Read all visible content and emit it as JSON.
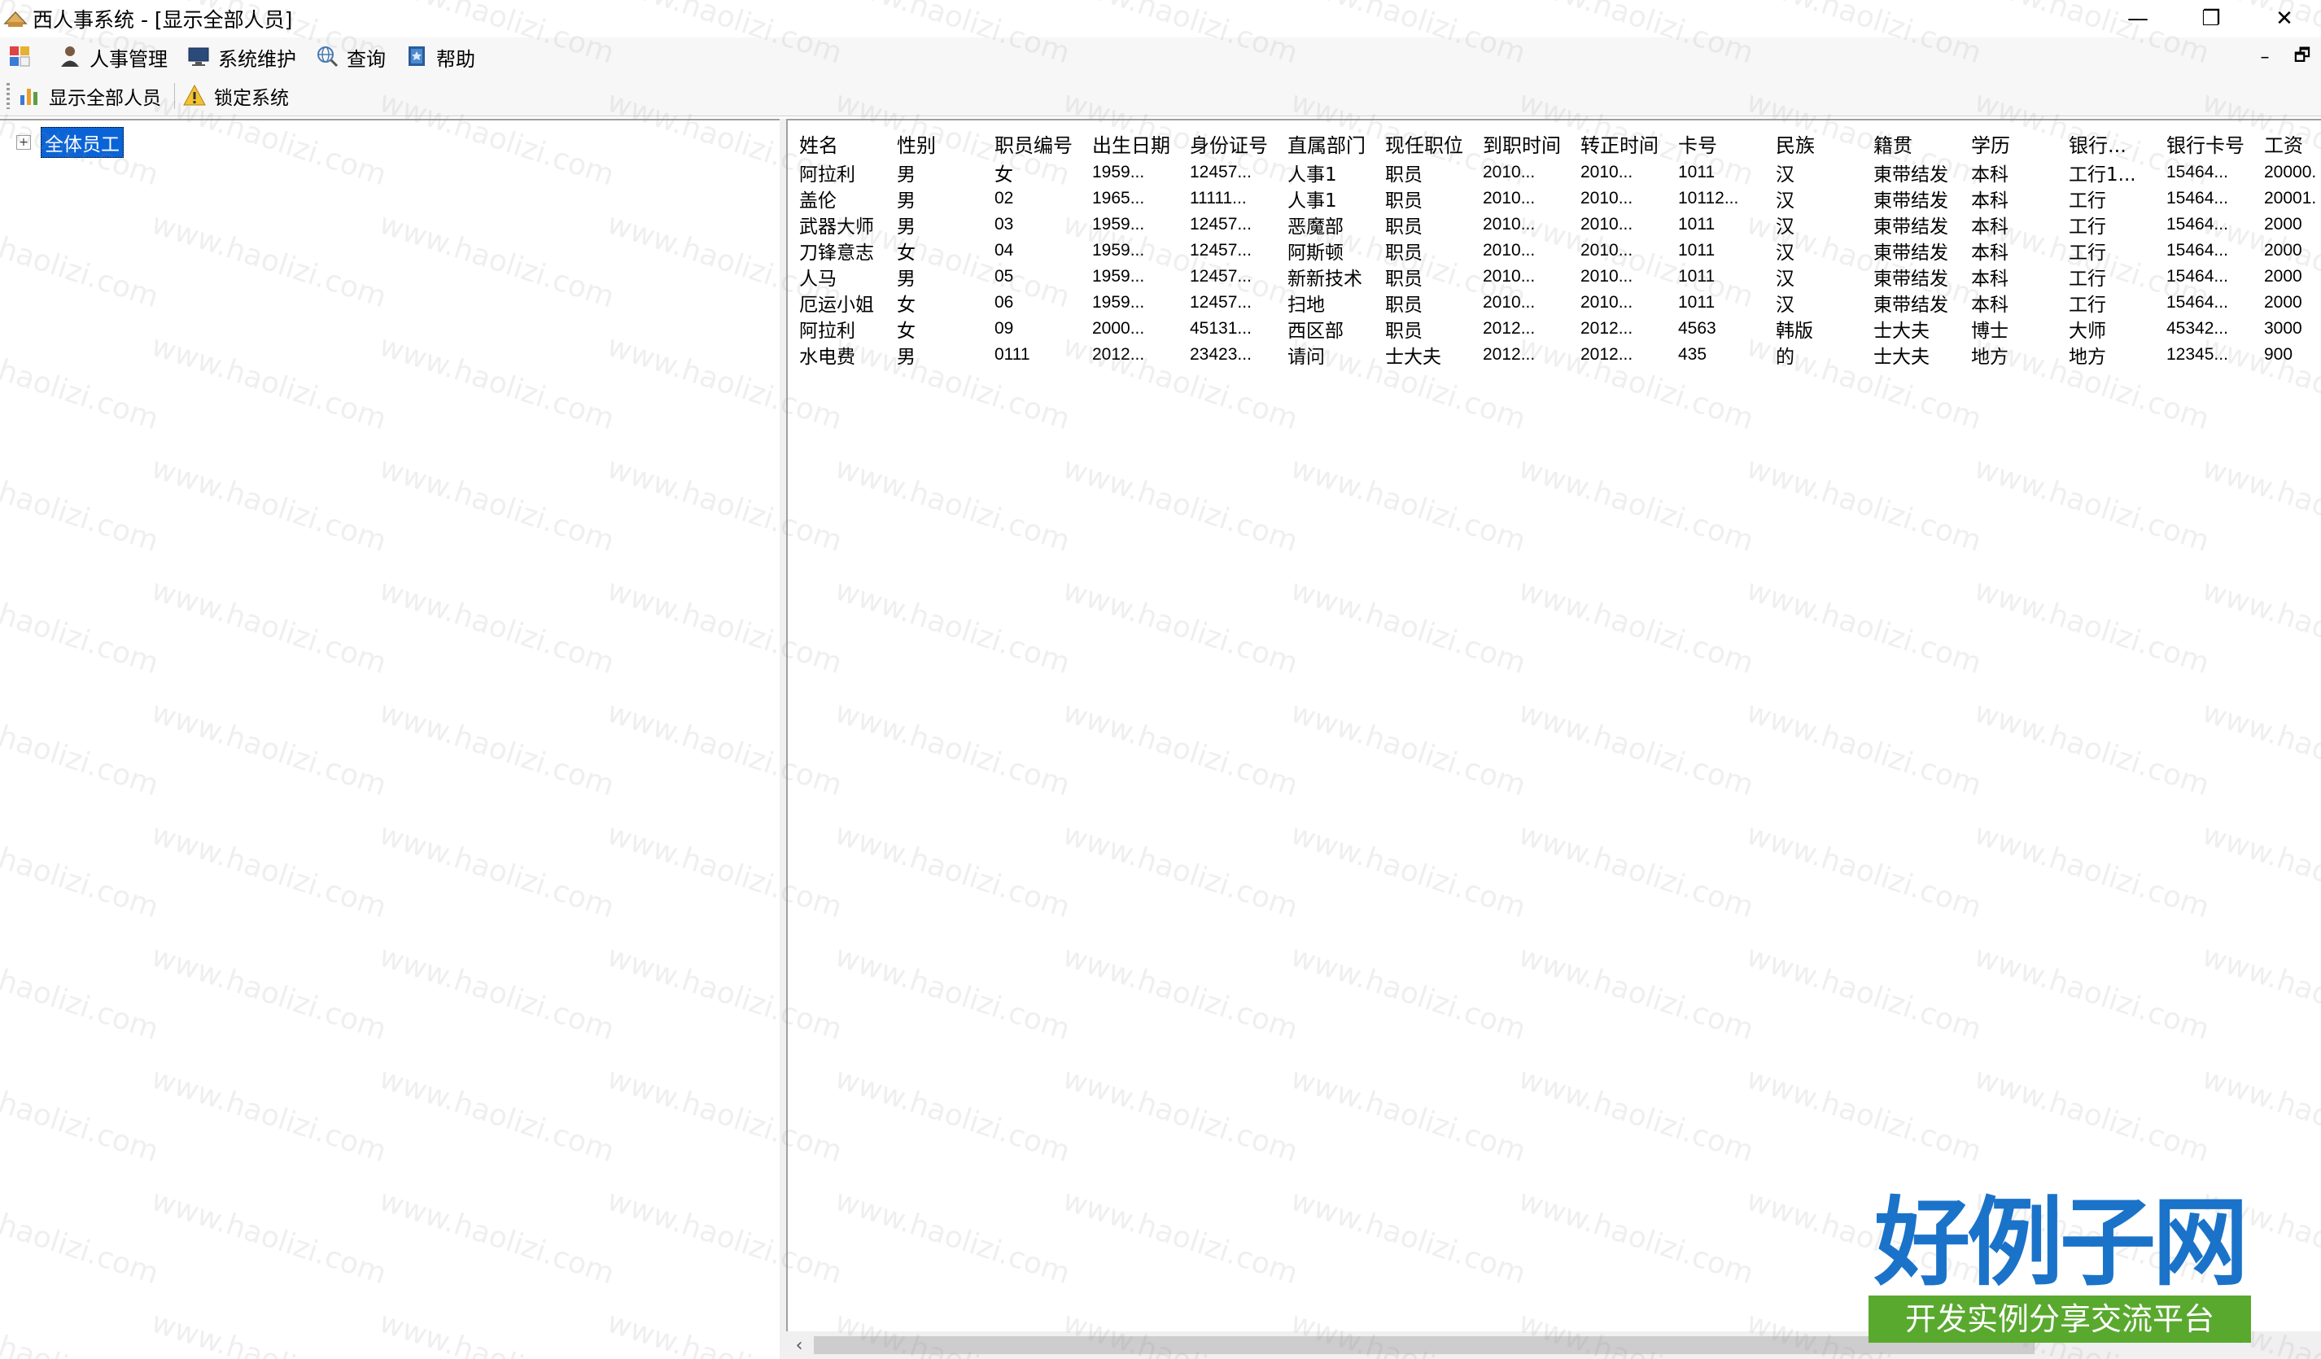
{
  "window": {
    "title": "西人事系统 - [显示全部人员]",
    "controls": {
      "minimize": "—",
      "restore": "❐",
      "close": "✕"
    }
  },
  "menu": {
    "items": [
      {
        "label": "人事管理",
        "icon": "person-icon"
      },
      {
        "label": "系统维护",
        "icon": "monitor-icon"
      },
      {
        "label": "查询",
        "icon": "globe-search-icon"
      },
      {
        "label": "帮助",
        "icon": "help-book-icon"
      }
    ],
    "mdi": {
      "minimize": "–",
      "restore": "🗗"
    }
  },
  "toolbar": {
    "items": [
      {
        "label": "显示全部人员",
        "icon": "bar-chart-icon"
      },
      {
        "label": "锁定系统",
        "icon": "warning-icon"
      }
    ]
  },
  "tree": {
    "root_label": "全体员工",
    "expander": "+"
  },
  "grid": {
    "columns": [
      "姓名",
      "性别",
      "职员编号",
      "出生日期",
      "身份证号",
      "直属部门",
      "现任职位",
      "到职时间",
      "转正时间",
      "卡号",
      "民族",
      "籍贯",
      "学历",
      "银行...",
      "银行卡号",
      "工资"
    ],
    "rows": [
      [
        "阿拉利",
        "男",
        "女",
        "1959...",
        "12457...",
        "人事1",
        "职员",
        "2010...",
        "2010...",
        "1011",
        "汉",
        "東带结发",
        "本科",
        "工行1...",
        "15464...",
        "20000."
      ],
      [
        "盖伦",
        "男",
        "02",
        "1965...",
        "11111...",
        "人事1",
        "职员",
        "2010...",
        "2010...",
        "10112...",
        "汉",
        "東带结发",
        "本科",
        "工行",
        "15464...",
        "20001."
      ],
      [
        "武器大师",
        "男",
        "03",
        "1959...",
        "12457...",
        "恶魔部",
        "职员",
        "2010...",
        "2010...",
        "1011",
        "汉",
        "東带结发",
        "本科",
        "工行",
        "15464...",
        "2000"
      ],
      [
        "刀锋意志",
        "女",
        "04",
        "1959...",
        "12457...",
        "阿斯顿",
        "职员",
        "2010...",
        "2010...",
        "1011",
        "汉",
        "東带结发",
        "本科",
        "工行",
        "15464...",
        "2000"
      ],
      [
        "人马",
        "男",
        "05",
        "1959...",
        "12457...",
        "新新技术",
        "职员",
        "2010...",
        "2010...",
        "1011",
        "汉",
        "東带结发",
        "本科",
        "工行",
        "15464...",
        "2000"
      ],
      [
        "厄运小姐",
        "女",
        "06",
        "1959...",
        "12457...",
        "扫地",
        "职员",
        "2010...",
        "2010...",
        "1011",
        "汉",
        "東带结发",
        "本科",
        "工行",
        "15464...",
        "2000"
      ],
      [
        "阿拉利",
        "女",
        "09",
        "2000...",
        "45131...",
        "西区部",
        "职员",
        "2012...",
        "2012...",
        "4563",
        "韩版",
        "士大夫",
        "博士",
        "大师",
        "45342...",
        "3000"
      ],
      [
        "水电费",
        "男",
        "0111",
        "2012...",
        "23423...",
        "请问",
        "士大夫",
        "2012...",
        "2012...",
        "435",
        "的",
        "士大夫",
        "地方",
        "地方",
        "12345...",
        "900"
      ]
    ]
  },
  "scrollbar": {
    "left_arrow": "‹"
  },
  "watermark": {
    "text": "www.haolizi.com"
  },
  "brand": {
    "main": "好例子网",
    "sub": "开发实例分享交流平台"
  },
  "colors": {
    "selection": "#0a64d8",
    "brand_blue": "#1a73c9",
    "brand_green": "#59a92e"
  }
}
